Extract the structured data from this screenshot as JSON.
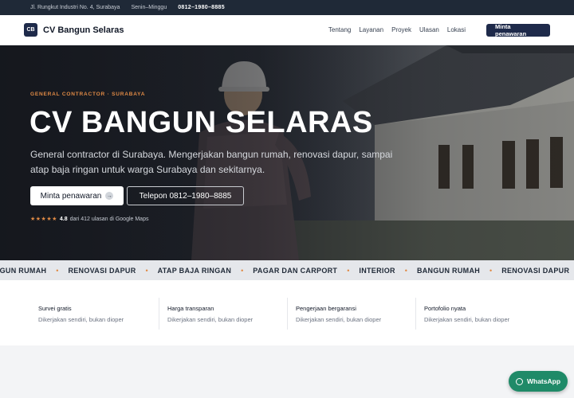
{
  "topbar": {
    "address": "Jl. Rungkut Industri No. 4, Surabaya",
    "hours": "Senin–Minggu",
    "phone": "0812–1980–8885"
  },
  "nav": {
    "logo_mark": "CB",
    "brand": "CV Bangun Selaras",
    "links": [
      "Tentang",
      "Layanan",
      "Proyek",
      "Ulasan",
      "Lokasi"
    ],
    "cta": "Minta penawaran"
  },
  "hero": {
    "eyebrow": "GENERAL CONTRACTOR · SURABAYA",
    "title": "CV BANGUN SELARAS",
    "subtitle": "General contractor di Surabaya. Mengerjakan bangun rumah, renovasi dapur, sampai atap baja ringan untuk warga Surabaya dan sekitarnya.",
    "primary_button": "Minta penawaran",
    "primary_arrow": "→",
    "secondary_button": "Telepon 0812–1980–8885",
    "stars": "★★★★★",
    "rating_score": "4.8",
    "rating_text": "dari 412 ulasan di Google Maps"
  },
  "marquee": {
    "items": [
      "ANGUN RUMAH",
      "RENOVASI DAPUR",
      "ATAP BAJA RINGAN",
      "PAGAR DAN CARPORT",
      "INTERIOR",
      "BANGUN RUMAH",
      "RENOVASI DAPUR"
    ],
    "separator": "•"
  },
  "features": [
    {
      "title": "Survei gratis",
      "desc": "Dikerjakan sendiri, bukan dioper"
    },
    {
      "title": "Harga transparan",
      "desc": "Dikerjakan sendiri, bukan dioper"
    },
    {
      "title": "Pengerjaan bergaransi",
      "desc": "Dikerjakan sendiri, bukan dioper"
    },
    {
      "title": "Portofolio nyata",
      "desc": "Dikerjakan sendiri, bukan dioper"
    }
  ],
  "whatsapp": {
    "label": "WhatsApp"
  },
  "colors": {
    "navy": "#1e2a4a",
    "accent": "#e08a45",
    "whatsapp": "#1f8a68"
  }
}
